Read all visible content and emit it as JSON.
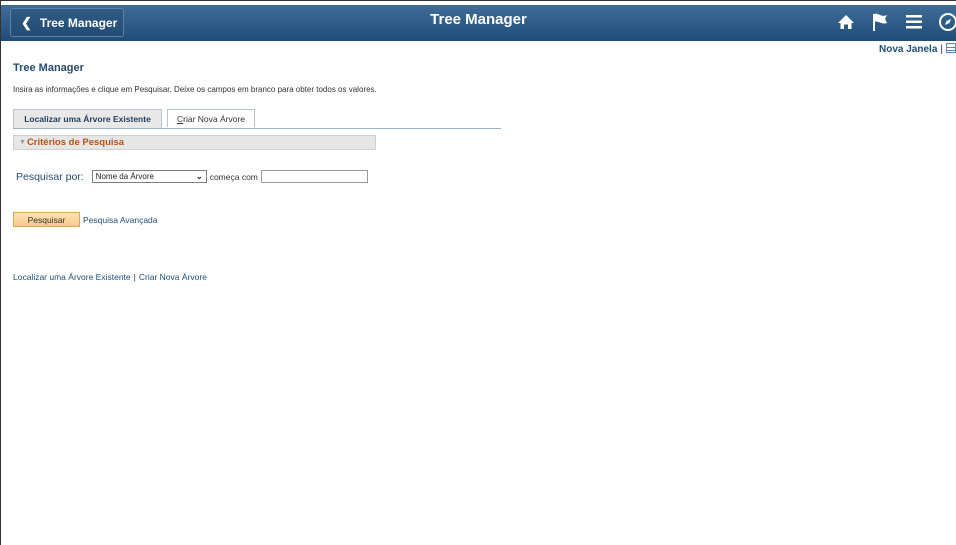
{
  "header": {
    "back_label": "Tree Manager",
    "title": "Tree Manager",
    "icons": [
      "home-icon",
      "flag-icon",
      "menu-icon",
      "navbar-compass-icon"
    ],
    "colors": {
      "bar": "#2b5a86",
      "text": "#ffffff"
    }
  },
  "top_links": {
    "new_window": "Nova Janela",
    "separator": "|"
  },
  "page": {
    "title": "Tree Manager",
    "instructions": "Insira as informações e clique em Pesquisar. Deixe os campos em branco para obter todos os valores."
  },
  "tabs": [
    {
      "label": "Localizar uma Árvore Existente",
      "active": true
    },
    {
      "label_first": "C",
      "label_rest": "riar Nova Árvore",
      "active": false
    }
  ],
  "criteria": {
    "label": "Critérios de Pesquisa",
    "color": "#b4531a"
  },
  "search": {
    "by_label": "Pesquisar por:",
    "selected_option": "Nome da Árvore",
    "operator_label": "começa com",
    "value": ""
  },
  "actions": {
    "search_button": "Pesquisar",
    "advanced_link": "Pesquisa Avançada"
  },
  "bottom_links": {
    "find": "Localizar uma Árvore Existente",
    "separator": "|",
    "create": "Criar Nova Árvore"
  }
}
